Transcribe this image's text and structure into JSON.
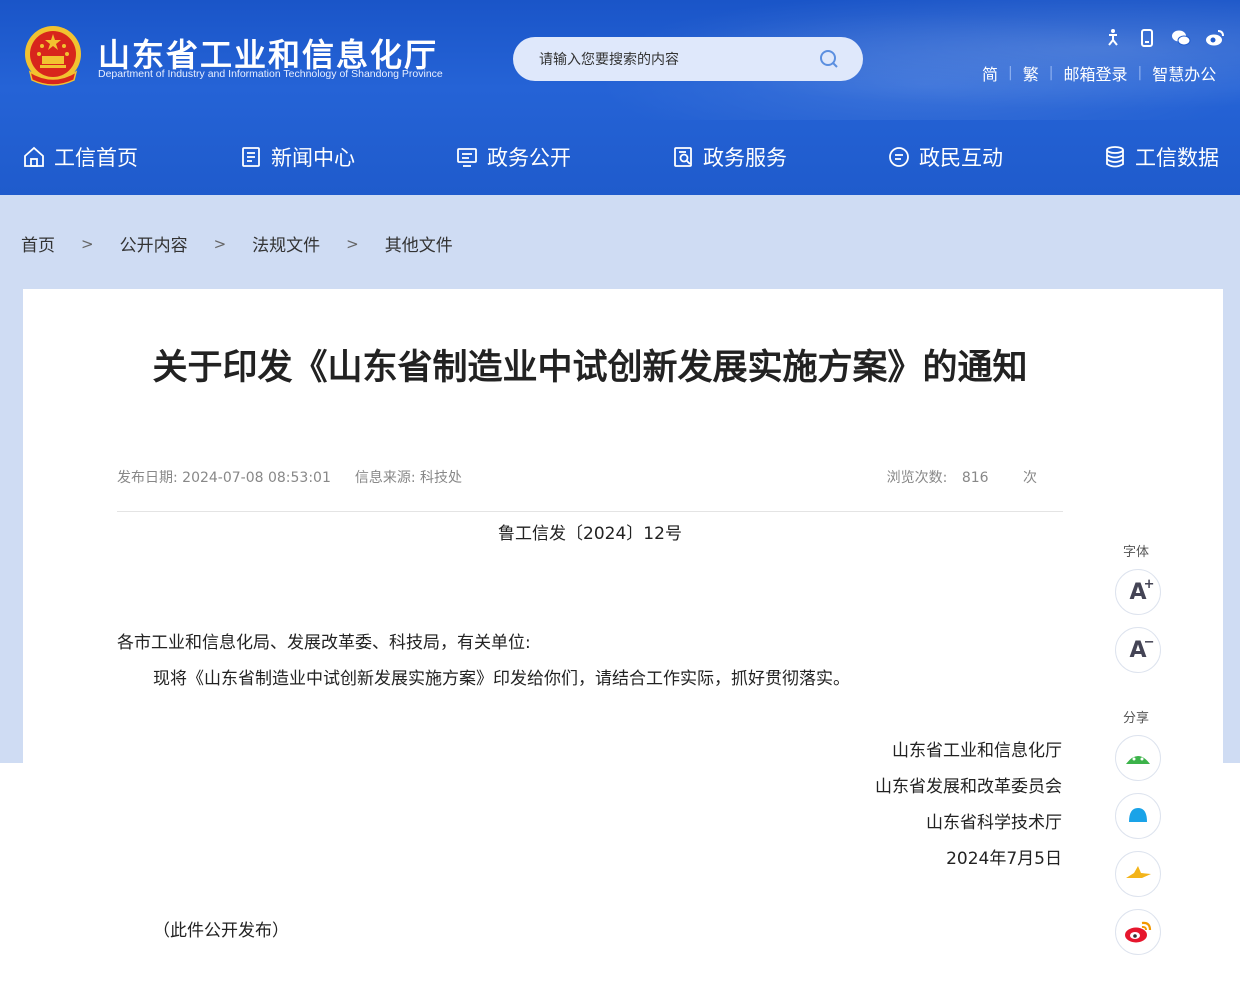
{
  "header": {
    "site_title": "山东省工业和信息化厅",
    "site_subtitle": "Department of Industry and Information Technology of Shandong Province",
    "search_placeholder": "请输入您要搜索的内容",
    "top_links": [
      "简",
      "繁",
      "邮箱登录",
      "智慧办公"
    ],
    "top_icons": [
      "accessibility-icon",
      "mobile-icon",
      "wechat-icon",
      "weibo-icon"
    ]
  },
  "nav": {
    "items": [
      {
        "label": "工信首页",
        "icon": "home-icon"
      },
      {
        "label": "新闻中心",
        "icon": "news-icon"
      },
      {
        "label": "政务公开",
        "icon": "monitor-icon"
      },
      {
        "label": "政务服务",
        "icon": "service-icon"
      },
      {
        "label": "政民互动",
        "icon": "chat-icon"
      },
      {
        "label": "工信数据",
        "icon": "database-icon"
      }
    ]
  },
  "breadcrumb": {
    "items": [
      "首页",
      "公开内容",
      "法规文件",
      "其他文件"
    ],
    "separator": ">"
  },
  "article": {
    "title": "关于印发《山东省制造业中试创新发展实施方案》的通知",
    "publish_date_label": "发布日期:",
    "publish_date": "2024-07-08 08:53:01",
    "source_label": "信息来源:",
    "source": "科技处",
    "views_label": "浏览次数:",
    "views": "816",
    "views_unit": "次",
    "doc_number": "鲁工信发〔2024〕12号",
    "salutation": "各市工业和信息化局、发展改革委、科技局，有关单位:",
    "paragraph": "现将《山东省制造业中试创新发展实施方案》印发给你们，请结合工作实际，抓好贯彻落实。",
    "signatories": [
      "山东省工业和信息化厅",
      "山东省发展和改革委员会",
      "山东省科学技术厅"
    ],
    "sign_date": "2024年7月5日",
    "note": "（此件公开发布）"
  },
  "side_tools": {
    "font_label": "字体",
    "font_increase": "A",
    "font_increase_sup": "+",
    "font_decrease": "A",
    "font_decrease_sup": "−",
    "share_label": "分享",
    "share_icons": [
      "wechat-share-icon",
      "qq-share-icon",
      "qzone-share-icon",
      "weibo-share-icon"
    ]
  },
  "colors": {
    "header_blue": "#1f5bcc",
    "band_blue": "#cfdcf3",
    "search_bg": "#dfe8fb"
  }
}
